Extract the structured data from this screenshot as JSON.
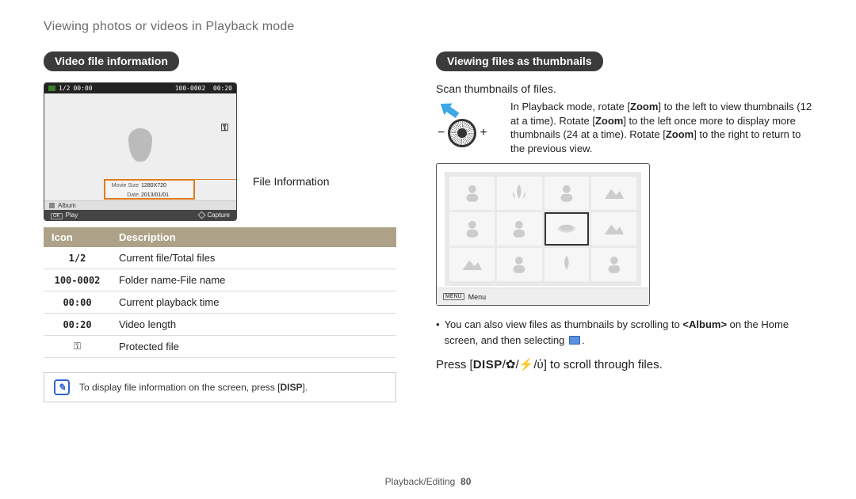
{
  "page_title": "Viewing photos or videos in Playback mode",
  "footer": {
    "section": "Playback/Editing",
    "page": "80"
  },
  "left": {
    "heading": "Video file information",
    "lcd_top": {
      "index": "1/2",
      "time": "00:00",
      "fileno": "100-0002",
      "length": "00:20"
    },
    "info_box": {
      "row1_label": "Movie Size",
      "row1_val": "1280X720",
      "row2_label": "Date",
      "row2_val": "2013/01/01"
    },
    "album_label": "Album",
    "play_label": "Play",
    "capture_label": "Capture",
    "caption": "File Information",
    "table": {
      "head_icon": "Icon",
      "head_desc": "Description",
      "rows": [
        {
          "icon": "1/2",
          "desc": "Current file/Total files"
        },
        {
          "icon": "100-0002",
          "desc": "Folder name-File name"
        },
        {
          "icon": "00:00",
          "desc": "Current playback time"
        },
        {
          "icon": "00:20",
          "desc": "Video length"
        },
        {
          "icon": "key",
          "desc": "Protected file"
        }
      ]
    },
    "note": "To display file information on the screen, press [DISP]."
  },
  "right": {
    "heading": "Viewing files as thumbnails",
    "intro": "Scan thumbnails of files.",
    "zoom_text_parts": [
      "In Playback mode, rotate [",
      "Zoom",
      "] to the left to view thumbnails (12 at a time). Rotate [",
      "Zoom",
      "] to the left once more to display more thumbnails (24 at a time). Rotate [",
      "Zoom",
      "] to the right to return to the previous view."
    ],
    "thumb_menu": "Menu",
    "bullets": [
      {
        "pre": "You can also view files as thumbnails by scrolling to ",
        "strong": "<Album>",
        "post": " on the Home screen, and then selecting "
      }
    ],
    "scroll": {
      "pre": "Press [",
      "disp": "DISP",
      "post": "] to scroll through files."
    }
  }
}
